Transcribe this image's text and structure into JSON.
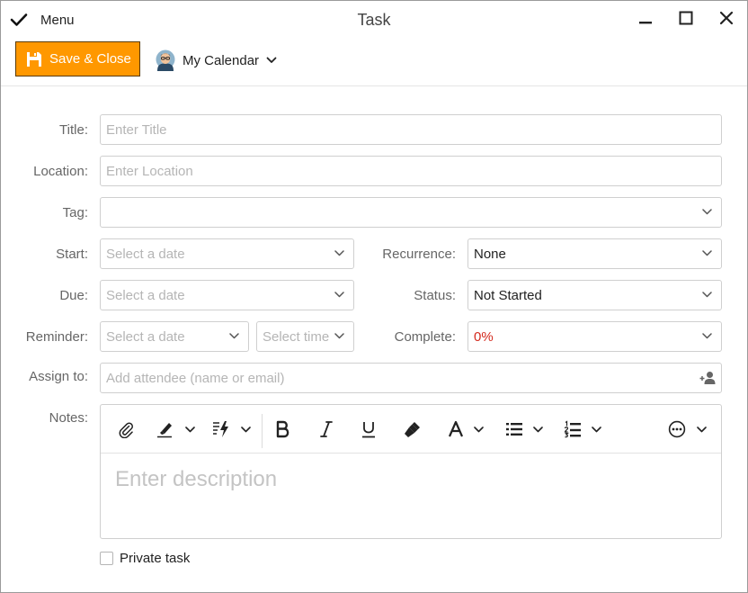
{
  "window": {
    "title": "Task",
    "menu_label": "Menu"
  },
  "toolbar": {
    "save_label": "Save & Close",
    "calendar_label": "My Calendar"
  },
  "form": {
    "title": {
      "label": "Title:",
      "placeholder": "Enter Title"
    },
    "location": {
      "label": "Location:",
      "placeholder": "Enter Location"
    },
    "tag": {
      "label": "Tag:",
      "value": ""
    },
    "start": {
      "label": "Start:",
      "placeholder": "Select a date"
    },
    "due": {
      "label": "Due:",
      "placeholder": "Select a date"
    },
    "reminder": {
      "label": "Reminder:",
      "date_placeholder": "Select a date",
      "time_placeholder": "Select time"
    },
    "recurrence": {
      "label": "Recurrence:",
      "value": "None"
    },
    "status": {
      "label": "Status:",
      "value": "Not Started"
    },
    "complete": {
      "label": "Complete:",
      "value": "0%"
    },
    "assign": {
      "label": "Assign to:",
      "placeholder": "Add attendee (name or email)"
    },
    "notes": {
      "label": "Notes:",
      "placeholder": "Enter description"
    },
    "private": {
      "label": "Private task",
      "checked": false
    }
  },
  "colors": {
    "accent": "#ff9800",
    "complete_value": "#d42a1e"
  },
  "icons": [
    "checkmark-icon",
    "minimize-icon",
    "maximize-icon",
    "close-icon",
    "save-icon",
    "avatar",
    "chevron-down-icon",
    "attachment-icon",
    "highlighter-icon",
    "quick-format-icon",
    "bold-icon",
    "italic-icon",
    "underline-icon",
    "format-painter-icon",
    "font-color-icon",
    "bullet-list-icon",
    "numbered-list-icon",
    "more-options-icon",
    "add-person-icon"
  ]
}
